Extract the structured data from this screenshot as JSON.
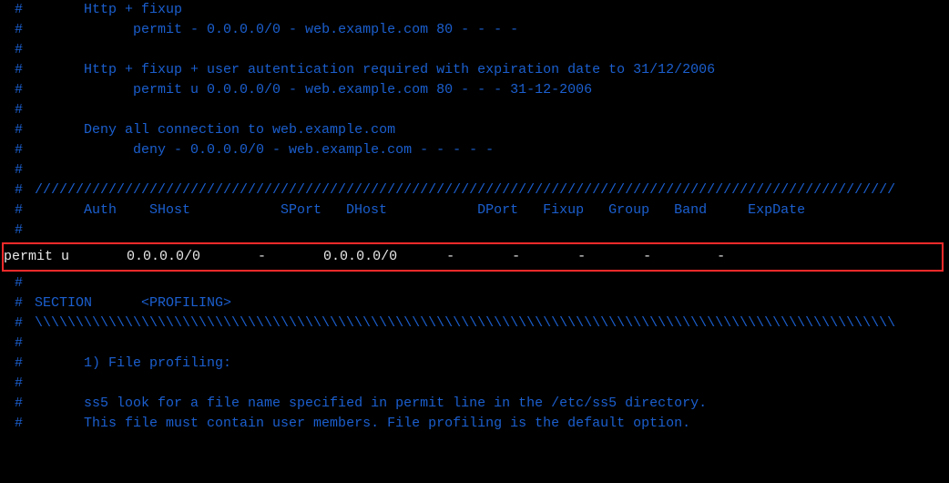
{
  "lines": {
    "l1_indent": "      ",
    "l1": "Http + fixup",
    "l2_indent": "            ",
    "l2": "permit - 0.0.0.0/0 - web.example.com 80 - - - -",
    "l3": "",
    "l4_indent": "      ",
    "l4": "Http + fixup + user autentication required with expiration date to 31/12/2006",
    "l5_indent": "            ",
    "l5": "permit u 0.0.0.0/0 - web.example.com 80 - - - 31-12-2006",
    "l6": "",
    "l7_indent": "      ",
    "l7": "Deny all connection to web.example.com",
    "l8_indent": "            ",
    "l8": "deny - 0.0.0.0/0 - web.example.com - - - - -",
    "l9": "",
    "divider_fwd": "/////////////////////////////////////////////////////////////////////////////////////////////////////////",
    "header_row": "      Auth    SHost           SPort   DHost           DPort   Fixup   Group   Band     ExpDate",
    "rule_row": "permit u       0.0.0.0/0       -       0.0.0.0/0      -       -       -       -        -",
    "l14": "",
    "section_label": "SECTION",
    "section_name": "<PROFILING>",
    "divider_back": "\\\\\\\\\\\\\\\\\\\\\\\\\\\\\\\\\\\\\\\\\\\\\\\\\\\\\\\\\\\\\\\\\\\\\\\\\\\\\\\\\\\\\\\\\\\\\\\\\\\\\\\\\\\\\\\\\\\\\\\\\\\\\\\\\\\\\\\\\\\\\\\\\\\\\\\\\\\\\\\\\\\\\\\\\\\\\\\\\\\\\\\\\\\\\\\\\\\\\\\\\\\\\\\\\\",
    "l17": "",
    "l18_indent": "      ",
    "l18": "1) File profiling:",
    "l19": "",
    "l20_indent": "      ",
    "l20": "ss5 look for a file name specified in permit line in the /etc/ss5 directory.",
    "l21_indent": "      ",
    "l21": "This file must contain user members. File profiling is the default option."
  }
}
